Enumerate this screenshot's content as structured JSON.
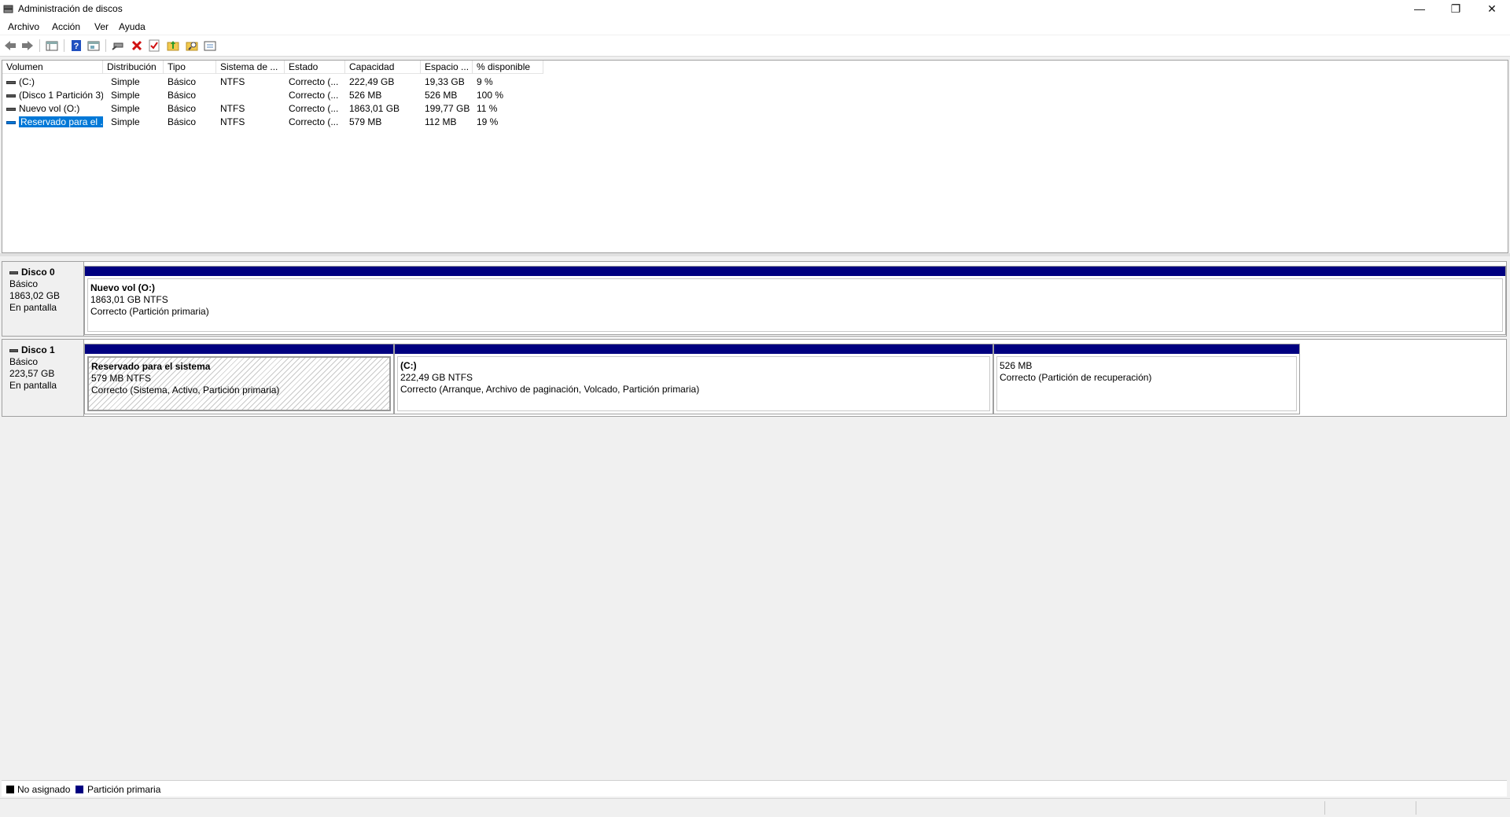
{
  "window": {
    "title": "Administración de discos",
    "minimize": "—",
    "restore": "❐",
    "close": "✕"
  },
  "menu": [
    "Archivo",
    "Acción",
    "Ver",
    "Ayuda"
  ],
  "toolbar": {
    "icons": [
      "back-icon",
      "forward-icon",
      "disk-list-icon",
      "help-icon",
      "properties-icon",
      "connect-icon",
      "delete-icon",
      "check-icon",
      "folder-up-icon",
      "folder-search-icon",
      "view-icon"
    ]
  },
  "volume_list": {
    "columns": [
      "Volumen",
      "Distribución",
      "Tipo",
      "Sistema de ...",
      "Estado",
      "Capacidad",
      "Espacio ...",
      "% disponible"
    ],
    "rows": [
      {
        "volume": "(C:)",
        "layout": "Simple",
        "type": "Básico",
        "fs": "NTFS",
        "status": "Correcto (...",
        "capacity": "222,49 GB",
        "free": "19,33 GB",
        "pct": "9 %"
      },
      {
        "volume": "(Disco 1 Partición 3)",
        "layout": "Simple",
        "type": "Básico",
        "fs": "",
        "status": "Correcto (...",
        "capacity": "526 MB",
        "free": "526 MB",
        "pct": "100 %"
      },
      {
        "volume": "Nuevo vol (O:)",
        "layout": "Simple",
        "type": "Básico",
        "fs": "NTFS",
        "status": "Correcto (...",
        "capacity": "1863,01 GB",
        "free": "199,77 GB",
        "pct": "11 %"
      },
      {
        "volume": "Reservado para el ...",
        "layout": "Simple",
        "type": "Básico",
        "fs": "NTFS",
        "status": "Correcto (...",
        "capacity": "579 MB",
        "free": "112 MB",
        "pct": "19 %"
      }
    ]
  },
  "disks": [
    {
      "name": "Disco 0",
      "type": "Básico",
      "size": "1863,02 GB",
      "state": "En pantalla",
      "partitions": [
        {
          "name": "Nuevo vol  (O:)",
          "size": "1863,01 GB NTFS",
          "status": "Correcto (Partición primaria)"
        }
      ]
    },
    {
      "name": "Disco 1",
      "type": "Básico",
      "size": "223,57 GB",
      "state": "En pantalla",
      "partitions": [
        {
          "name": "Reservado para el sistema",
          "size": "579 MB NTFS",
          "status": "Correcto (Sistema, Activo, Partición primaria)"
        },
        {
          "name": "(C:)",
          "size": "222,49 GB NTFS",
          "status": "Correcto (Arranque, Archivo de paginación, Volcado, Partición primaria)"
        },
        {
          "name": "",
          "size": "526 MB",
          "status": "Correcto (Partición de recuperación)"
        }
      ]
    }
  ],
  "legend": [
    {
      "label": "No asignado",
      "color": "#000000"
    },
    {
      "label": "Partición primaria",
      "color": "#000080"
    }
  ],
  "colors": {
    "primary_partition": "#000080",
    "selection": "#0078d7"
  }
}
